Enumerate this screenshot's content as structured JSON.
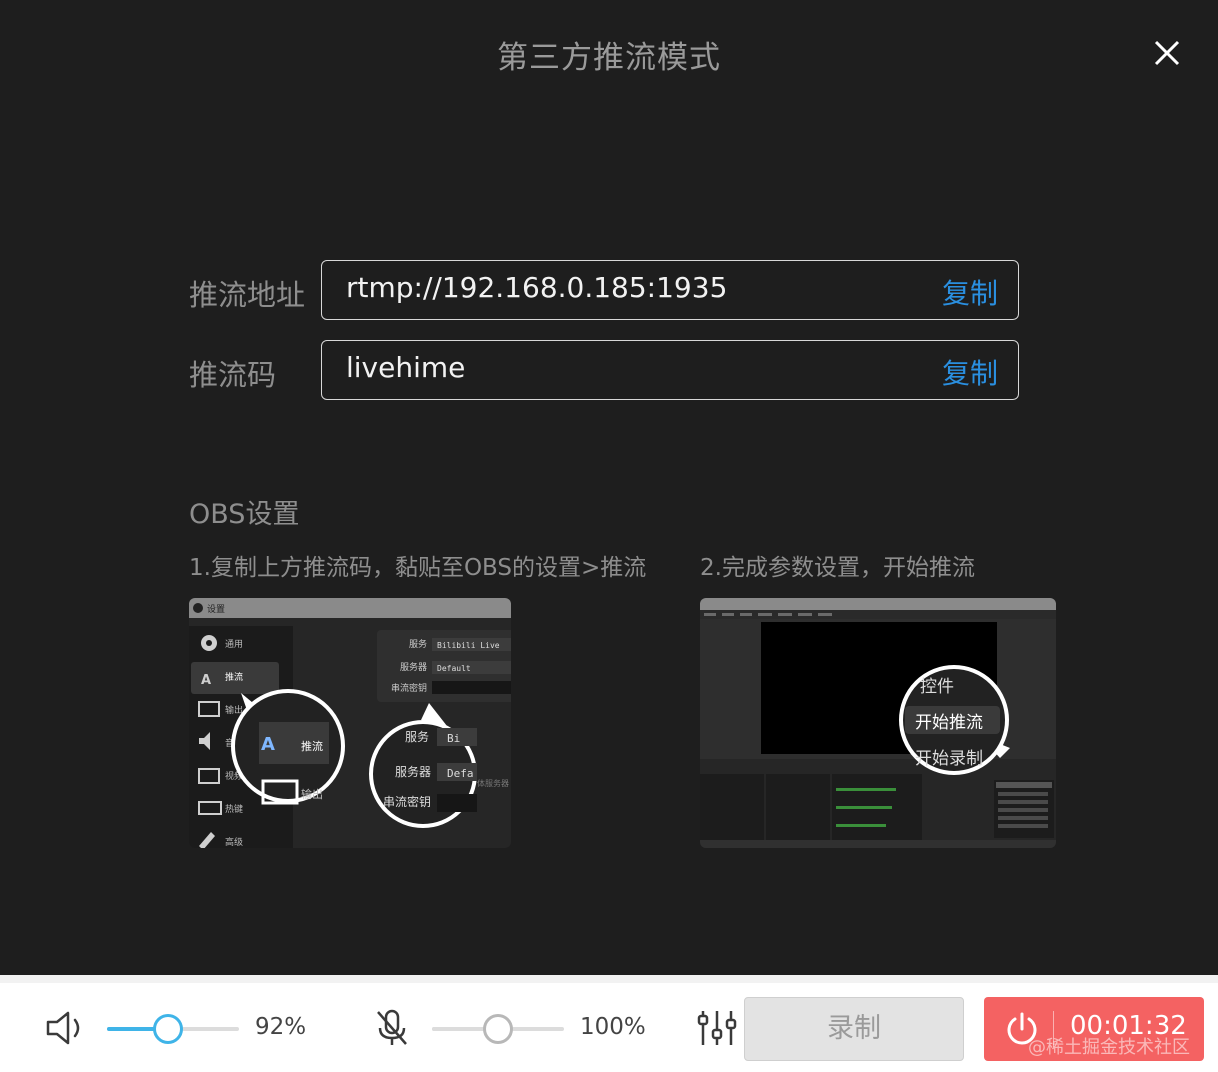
{
  "dialog": {
    "title": "第三方推流模式",
    "stream_url": {
      "label": "推流地址",
      "value": "rtmp://192.168.0.185:1935",
      "copy_label": "复制"
    },
    "stream_key": {
      "label": "推流码",
      "value": "livehime",
      "copy_label": "复制"
    },
    "obs": {
      "title": "OBS设置",
      "step1": "1.复制上方推流码，黏贴至OBS的设置>推流",
      "step2": "2.完成参数设置，开始推流",
      "shot1": {
        "window_title": "设置",
        "nav": [
          "通用",
          "推流",
          "输出",
          "音频",
          "视频",
          "热键",
          "高级"
        ],
        "zoom_nav_stream": "推流",
        "zoom_nav_output": "输出",
        "service_label": "服务",
        "service_value": "Bilibili Live",
        "server_label": "服务器",
        "server_value": "Default",
        "key_label": "串流密钥",
        "zoom_service_value": "Bi",
        "zoom_server_value": "Defa",
        "side_text": "体服务器"
      },
      "shot2": {
        "controls_label": "控件",
        "start_stream": "开始推流",
        "start_record": "开始录制"
      }
    }
  },
  "bottom_bar": {
    "speaker_volume": 0.46,
    "speaker_volume_label": "92%",
    "mic_volume": 0.5,
    "mic_volume_label": "100%",
    "record_label": "录制",
    "live_timer": "00:01:32",
    "watermark": "@稀土掘金技术社区"
  },
  "colors": {
    "accent": "#2a8fe0",
    "slider": "#3fb4e8",
    "live": "#f46262",
    "dialog_bg": "#1e1e1e"
  }
}
